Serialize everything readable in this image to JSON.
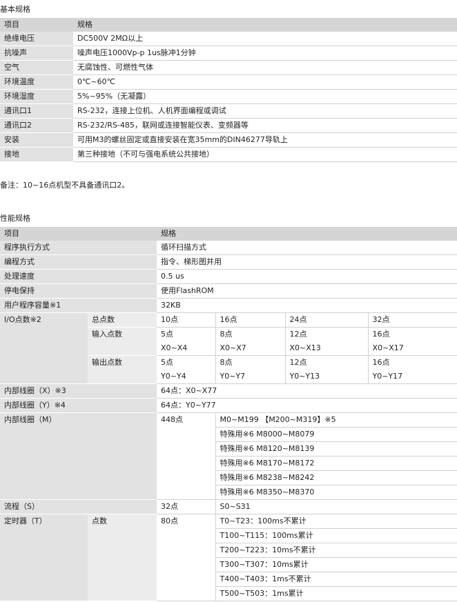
{
  "basic": {
    "title": "基本规格",
    "headers": [
      "项目",
      "规格"
    ],
    "rows": [
      [
        "绝缘电压",
        "DC500V   2MΩ以上"
      ],
      [
        "抗噪声",
        "噪声电压1000Vp-p  1us脉冲1分钟"
      ],
      [
        "空气",
        "无腐蚀性、可燃性气体"
      ],
      [
        "环境温度",
        "0℃~60℃"
      ],
      [
        "环境湿度",
        "5%~95%（无凝露）"
      ],
      [
        "通讯口1",
        "RS-232，连接上位机、人机界面编程或调试"
      ],
      [
        "通讯口2",
        "RS-232/RS-485，联网或连接智能仪表、变频器等"
      ],
      [
        "安装",
        "可用M3的螺丝固定或直接安装在宽35mm的DIN46277导轨上"
      ],
      [
        "接地",
        "第三种接地（不可与强电系统公共接地）"
      ]
    ],
    "note": "备注：10~16点机型不具备通讯口2。"
  },
  "perf": {
    "title": "性能规格",
    "headers": [
      "项目",
      "规格"
    ],
    "exec_mode": {
      "label": "程序执行方式",
      "value": "循环扫描方式"
    },
    "program_mode": {
      "label": "编程方式",
      "value": "指令、梯形图并用"
    },
    "speed": {
      "label": "处理速度",
      "value": "0.5 us"
    },
    "power_retain": {
      "label": "停电保持",
      "value": "使用FlashROM"
    },
    "capacity": {
      "label": "用户程序容量※1",
      "value": "32KB"
    },
    "io": {
      "label": "I/O点数※2",
      "total_label": "总点数",
      "totals": [
        "10点",
        "16点",
        "24点",
        "32点"
      ],
      "input_label": "输入点数",
      "input_counts": [
        "5点",
        "8点",
        "12点",
        "16点"
      ],
      "input_ranges": [
        "X0~X4",
        "X0~X7",
        "X0~X13",
        "X0~X17"
      ],
      "output_label": "输出点数",
      "output_counts": [
        "5点",
        "8点",
        "12点",
        "16点"
      ],
      "output_ranges": [
        "Y0~Y4",
        "Y0~Y7",
        "Y0~Y13",
        "Y0~Y17"
      ]
    },
    "coil_x": {
      "label": "内部线圈（X）※3",
      "value": "64点：X0~X77"
    },
    "coil_y": {
      "label": "内部线圈（Y）※4",
      "value": "64点：Y0~Y77"
    },
    "coil_m": {
      "label": "内部线圈（M）",
      "count": "448点",
      "items": [
        "M0~M199  【M200~M319】※5",
        "特殊用※6  M8000~M8079",
        "特殊用※6  M8120~M8139",
        "特殊用※6  M8170~M8172",
        "特殊用※6  M8238~M8242",
        "特殊用※6  M8350~M8370"
      ]
    },
    "flow": {
      "label": "流程（S）",
      "count": "32点",
      "value": "S0~S31"
    },
    "timer": {
      "label": "定时器（T）",
      "sub_label": "点数",
      "count": "80点",
      "items": [
        "T0~T23：100ms不累计",
        "T100~T115：100ms累计",
        "T200~T223：10ms不累计",
        "T300~T307：10ms累计",
        "T400~T403：1ms不累计",
        "T500~T503：1ms累计"
      ]
    }
  }
}
